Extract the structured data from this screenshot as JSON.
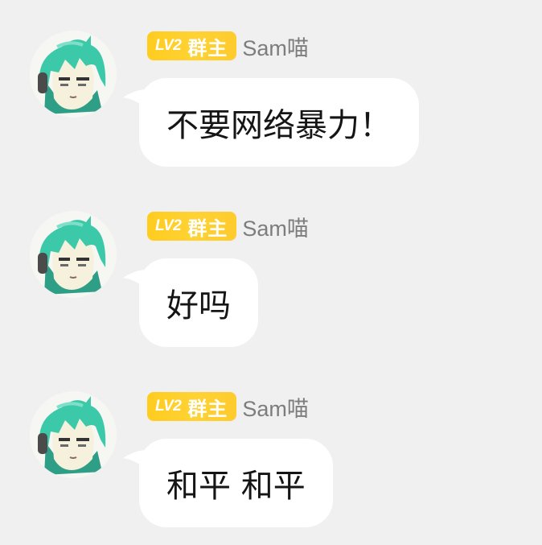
{
  "colors": {
    "background": "#f0f0f1",
    "bubble": "#ffffff",
    "badge": "#ffd02a",
    "badge_text": "#ffffff",
    "name_text": "#7d7d7d",
    "message_text": "#151515",
    "avatar_hair": "#3cc9a9"
  },
  "messages": [
    {
      "avatar_icon": "avatar-teal-hair-character",
      "badge_level": "LV2",
      "badge_role": "群主",
      "sender": "Sam喵",
      "text": "不要网络暴力！"
    },
    {
      "avatar_icon": "avatar-teal-hair-character",
      "badge_level": "LV2",
      "badge_role": "群主",
      "sender": "Sam喵",
      "text": "好吗"
    },
    {
      "avatar_icon": "avatar-teal-hair-character",
      "badge_level": "LV2",
      "badge_role": "群主",
      "sender": "Sam喵",
      "text": "和平 和平"
    }
  ]
}
